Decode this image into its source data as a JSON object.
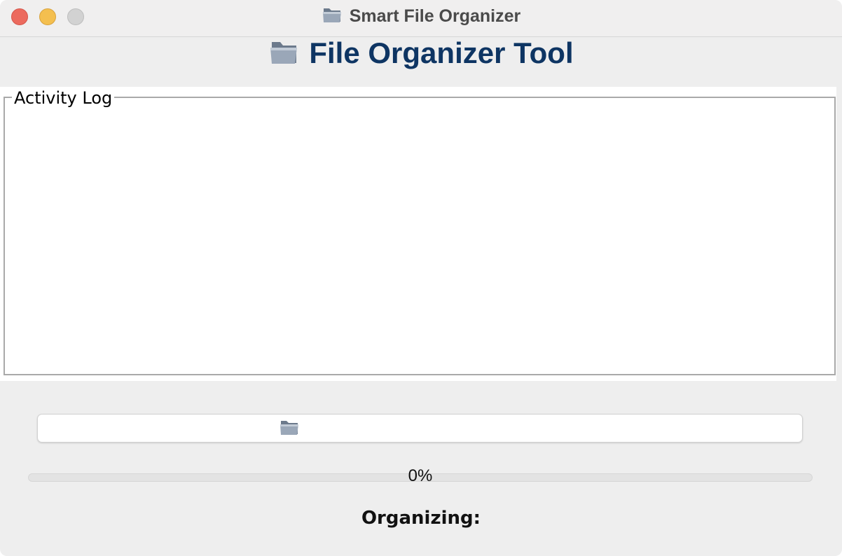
{
  "window": {
    "title": "Smart File Organizer",
    "title_icon": "folder-icon"
  },
  "header": {
    "icon": "folder-icon",
    "title": "File Organizer Tool"
  },
  "activity_log": {
    "legend": "Activity Log",
    "entries": []
  },
  "folder_field": {
    "icon": "folder-icon",
    "value": ""
  },
  "progress": {
    "value": 0,
    "label": "0%"
  },
  "status": {
    "text": "Organizing:"
  },
  "colors": {
    "heading": "#0e3563",
    "close": "#ec6a5e",
    "minimize": "#f4bf4f",
    "zoom": "#d2d2d2",
    "window_bg": "#eeeeee",
    "panel_bg": "#ffffff"
  }
}
